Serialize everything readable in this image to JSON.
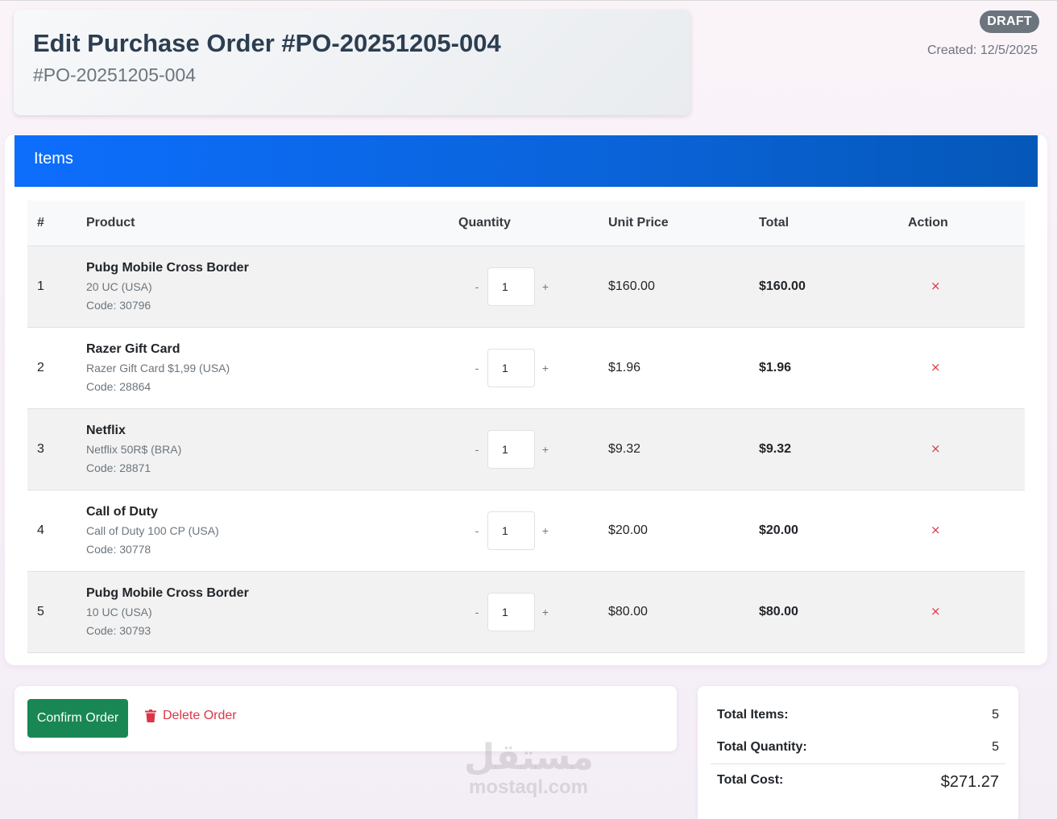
{
  "header": {
    "title": "Edit Purchase Order #PO-20251205-004",
    "subtitle": "#PO-20251205-004",
    "status": "DRAFT",
    "created": "Created: 12/5/2025"
  },
  "items": {
    "title": "Items",
    "columns": [
      "#",
      "Product",
      "Quantity",
      "Unit Price",
      "Total",
      "Action"
    ],
    "rows": [
      {
        "num": "1",
        "name": "Pubg Mobile Cross Border",
        "desc": "20 UC (USA)",
        "code": "Code: 30796",
        "qty": "1",
        "unit_price": "$160.00",
        "total": "$160.00"
      },
      {
        "num": "2",
        "name": "Razer Gift Card",
        "desc": "Razer Gift Card $1,99 (USA)",
        "code": "Code: 28864",
        "qty": "1",
        "unit_price": "$1.96",
        "total": "$1.96"
      },
      {
        "num": "3",
        "name": "Netflix",
        "desc": "Netflix 50R$ (BRA)",
        "code": "Code: 28871",
        "qty": "1",
        "unit_price": "$9.32",
        "total": "$9.32"
      },
      {
        "num": "4",
        "name": "Call of Duty",
        "desc": "Call of Duty 100 CP (USA)",
        "code": "Code: 30778",
        "qty": "1",
        "unit_price": "$20.00",
        "total": "$20.00"
      },
      {
        "num": "5",
        "name": "Pubg Mobile Cross Border",
        "desc": "10 UC (USA)",
        "code": "Code: 30793",
        "qty": "1",
        "unit_price": "$80.00",
        "total": "$80.00"
      }
    ],
    "minus_label": "-",
    "plus_label": "+",
    "remove_label": "×"
  },
  "actions": {
    "confirm_label": "Confirm Order",
    "delete_label": "Delete Order"
  },
  "summary": {
    "total_items_label": "Total Items:",
    "total_items_value": "5",
    "total_quantity_label": "Total Quantity:",
    "total_quantity_value": "5",
    "total_cost_label": "Total Cost:",
    "total_cost_value": "$271.27"
  },
  "watermark": {
    "logo": "مستقل",
    "text": "mostaql.com"
  },
  "colors": {
    "primary": "#0d6efd",
    "success": "#198754",
    "danger": "#dc3545",
    "badge": "#6c757d"
  }
}
